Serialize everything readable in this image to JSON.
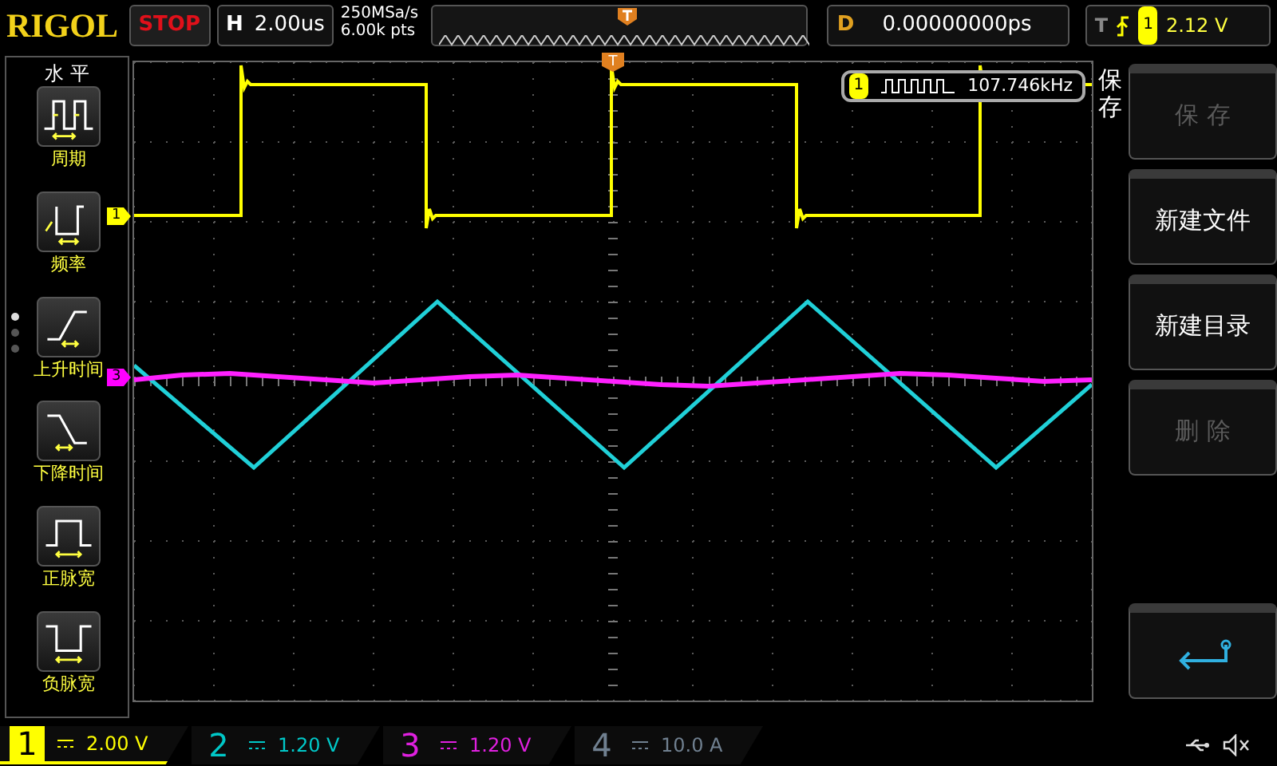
{
  "header": {
    "logo": "RIGOL",
    "run_state": "STOP",
    "timebase_label": "H",
    "timebase": "2.00us",
    "sample_rate": "250MSa/s",
    "memory_depth": "6.00k pts",
    "delay_label": "D",
    "delay": "0.00000000ps",
    "trigger_label": "T",
    "trigger_source": "1",
    "trigger_level": "2.12 V"
  },
  "left_menu": {
    "title": "水 平",
    "page_dots": [
      {
        "selected": true
      },
      {
        "selected": false
      },
      {
        "selected": false
      }
    ],
    "items": [
      {
        "kind": "period",
        "label": "周期"
      },
      {
        "kind": "frequency",
        "label": "频率"
      },
      {
        "kind": "rise",
        "label": "上升时间"
      },
      {
        "kind": "fall",
        "label": "下降时间"
      },
      {
        "kind": "poswidth",
        "label": "正脉宽"
      },
      {
        "kind": "negwidth",
        "label": "负脉宽"
      }
    ]
  },
  "plot": {
    "trigger_marker": "T",
    "channel_markers": [
      {
        "label": "1",
        "color": "#ffff00"
      },
      {
        "label": "3",
        "color": "#ff00ff"
      }
    ],
    "measurement": {
      "channel": "1",
      "value": "107.746kHz"
    }
  },
  "right_menu": {
    "title": "保存",
    "buttons": [
      {
        "label": "保 存",
        "disabled": true
      },
      {
        "label": "新建文件",
        "disabled": false
      },
      {
        "label": "新建目录",
        "disabled": false
      },
      {
        "label": "删 除",
        "disabled": true
      }
    ]
  },
  "channels": [
    {
      "number": "1",
      "scale": "2.00 V",
      "color": "#ffff00",
      "selected": true
    },
    {
      "number": "2",
      "scale": "1.20 V",
      "color": "#00c8c8",
      "selected": false
    },
    {
      "number": "3",
      "scale": "1.20 V",
      "color": "#e020e0",
      "selected": false
    },
    {
      "number": "4",
      "scale": "10.0 A",
      "color": "#708090",
      "selected": false
    }
  ]
}
